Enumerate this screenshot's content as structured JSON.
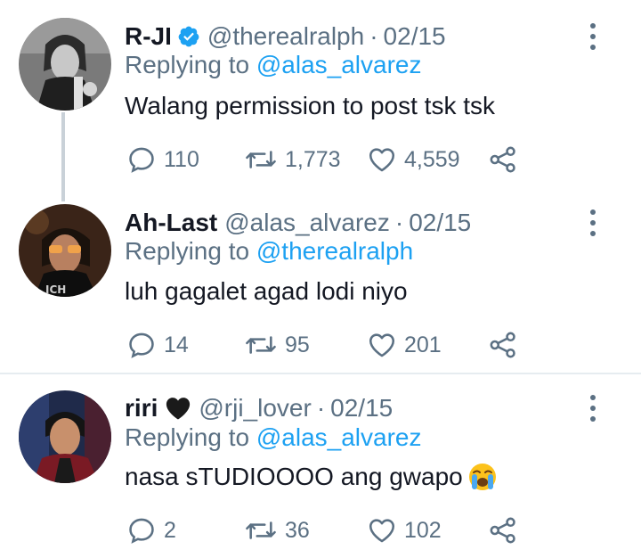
{
  "tweets": [
    {
      "name": "R-JI",
      "verified": true,
      "handle": "@therealralph",
      "separator": "·",
      "date": "02/15",
      "reply_prefix": "Replying to",
      "reply_to": "@alas_alvarez",
      "text": "Walang permission to post tsk tsk",
      "replies": "110",
      "retweets": "1,773",
      "likes": "4,559"
    },
    {
      "name": "Ah-Last",
      "verified": false,
      "handle": "@alas_alvarez",
      "separator": "·",
      "date": "02/15",
      "reply_prefix": "Replying to",
      "reply_to": "@therealralph",
      "text": "luh gagalet agad lodi niyo",
      "replies": "14",
      "retweets": "95",
      "likes": "201"
    },
    {
      "name": "riri",
      "name_emoji": "black-heart",
      "verified": false,
      "handle": "@rji_lover",
      "separator": "·",
      "date": "02/15",
      "reply_prefix": "Replying to",
      "reply_to": "@alas_alvarez",
      "text": "nasa sTUDIOOOO ang gwapo",
      "text_emoji": "loudly-crying-face",
      "replies": "2",
      "retweets": "36",
      "likes": "102"
    }
  ],
  "colors": {
    "link": "#1da1f2",
    "muted": "#5b7083",
    "text": "#141823",
    "divider": "#e6ecf0",
    "thread_line": "#c9d1d8"
  }
}
